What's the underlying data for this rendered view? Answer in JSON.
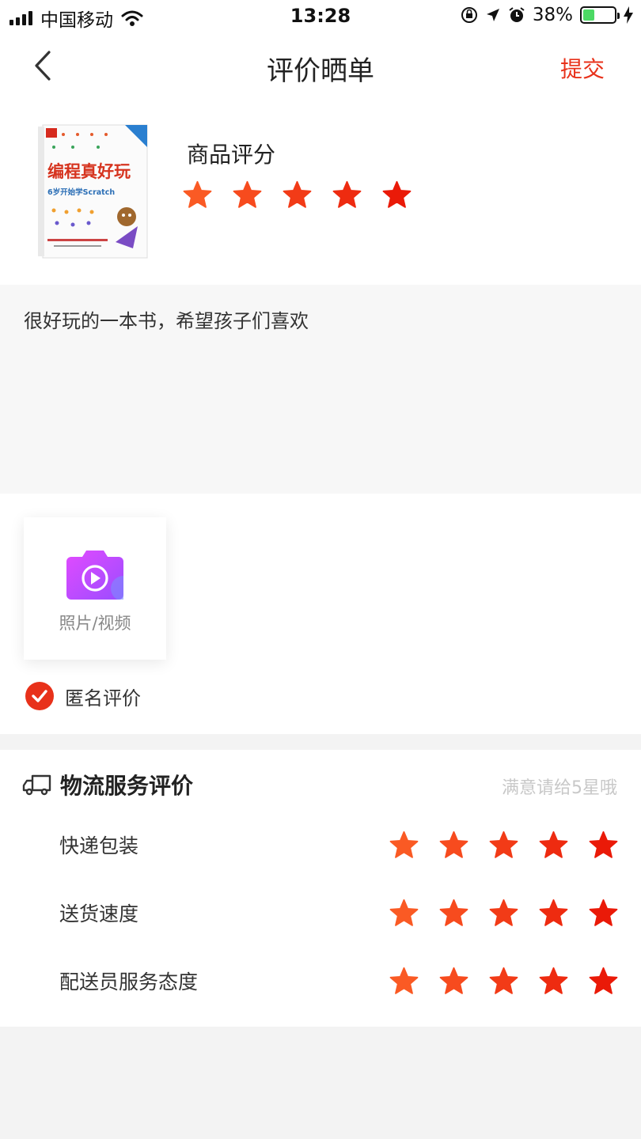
{
  "status_bar": {
    "carrier": "中国移动",
    "time": "13:28",
    "battery": "38%",
    "battery_level": 0.38
  },
  "nav": {
    "title": "评价晒单",
    "submit_label": "提交",
    "back_icon": "chevron-left-icon"
  },
  "product": {
    "cover_title": "编程真好玩",
    "cover_subtitle": "6岁开始学Scratch",
    "rating_label": "商品评分",
    "rating": 5
  },
  "comment": {
    "text": "很好玩的一本书，希望孩子们喜欢"
  },
  "media": {
    "upload_label": "照片/视频",
    "anonymous_label": "匿名评价",
    "anonymous_checked": true
  },
  "logistics": {
    "title": "物流服务评价",
    "hint": "满意请给5星哦",
    "items": [
      {
        "label": "快递包装",
        "rating": 5
      },
      {
        "label": "送货速度",
        "rating": 5
      },
      {
        "label": "配送员服务态度",
        "rating": 5
      }
    ]
  },
  "colors": {
    "accent": "#e8311a",
    "star_colors": [
      "#fa5a24",
      "#f74b1e",
      "#f23b17",
      "#ee2b10",
      "#ea1a08"
    ]
  }
}
